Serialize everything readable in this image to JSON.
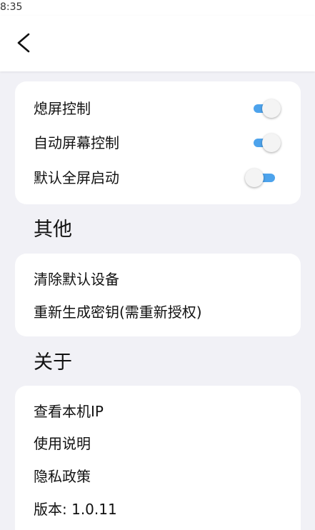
{
  "status_bar": {
    "time": "8:35"
  },
  "app_bar": {
    "back_icon": "chevron-left-icon"
  },
  "display_section": {
    "items": [
      {
        "label": "熄屏控制",
        "toggle": "on"
      },
      {
        "label": "自动屏幕控制",
        "toggle": "on"
      },
      {
        "label": "默认全屏启动",
        "toggle": "off"
      }
    ]
  },
  "other_section": {
    "title": "其他",
    "items": [
      {
        "label": "清除默认设备"
      },
      {
        "label": "重新生成密钥(需重新授权)"
      }
    ]
  },
  "about_section": {
    "title": "关于",
    "items": [
      {
        "label": "查看本机IP"
      },
      {
        "label": "使用说明"
      },
      {
        "label": "隐私政策"
      },
      {
        "label": "版本: 1.0.11"
      }
    ]
  },
  "colors": {
    "background": "#f1f1f6",
    "card": "#ffffff",
    "toggle_track": "#4da3ec",
    "toggle_thumb": "#f4f4f4"
  }
}
